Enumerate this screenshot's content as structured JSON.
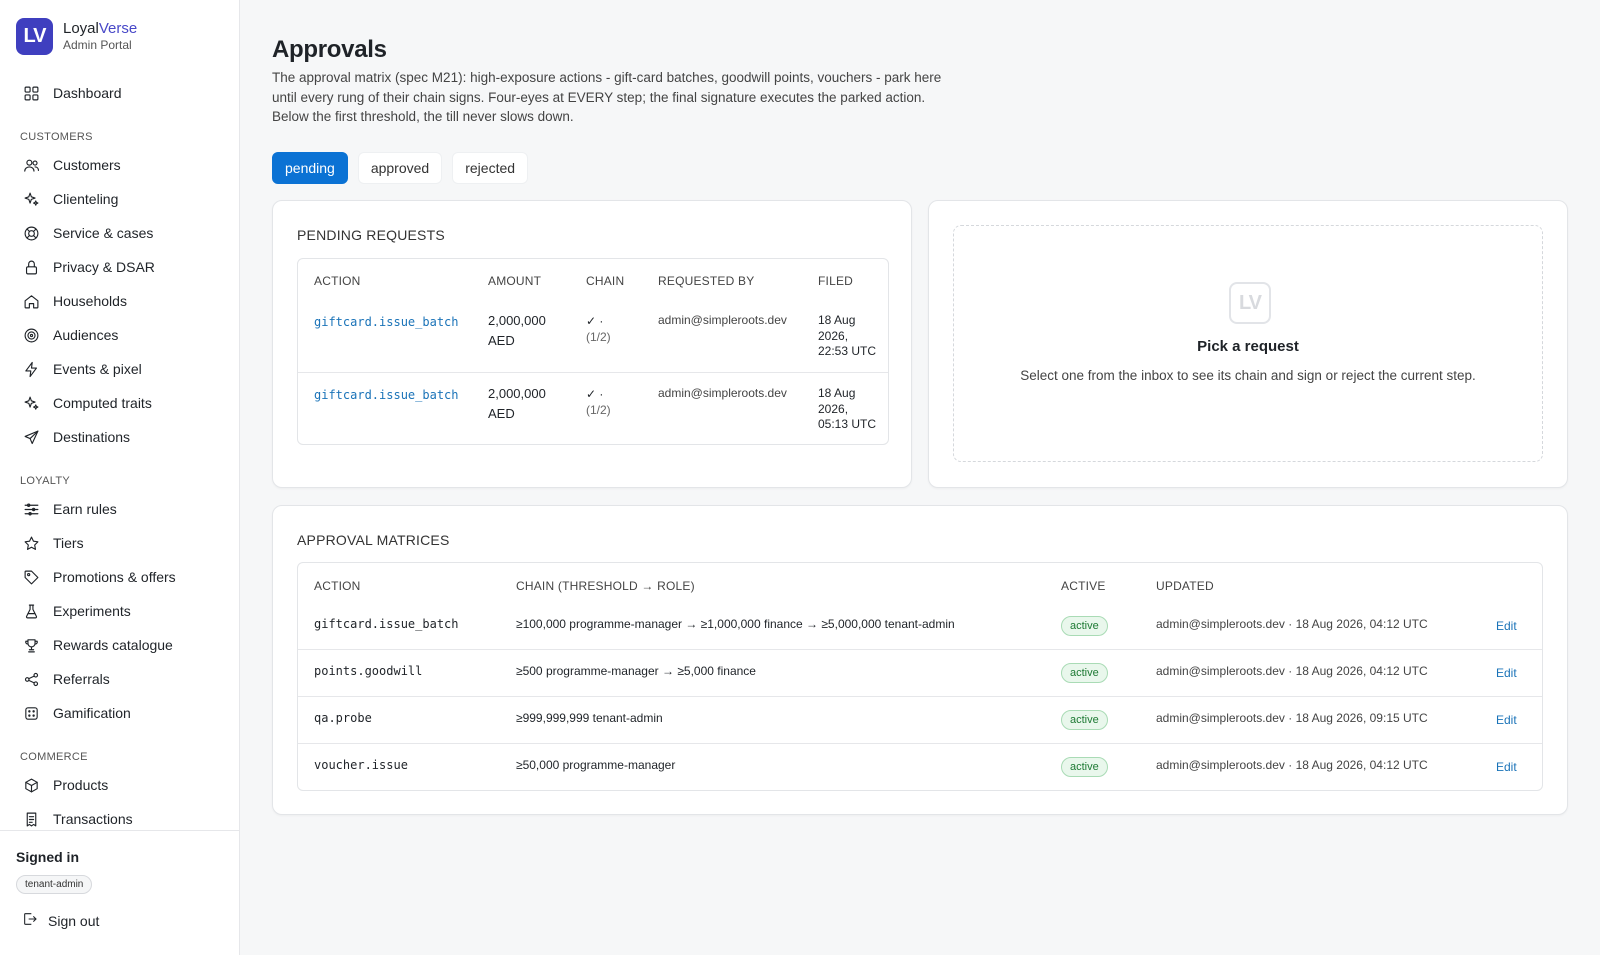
{
  "brand": {
    "logo_text": "LV",
    "name_a": "Loyal",
    "name_b": "Verse",
    "subtitle": "Admin Portal"
  },
  "nav": {
    "dashboard": "Dashboard",
    "sections": {
      "customers": "CUSTOMERS",
      "loyalty": "LOYALTY",
      "commerce": "COMMERCE"
    },
    "customers_items": [
      "Customers",
      "Clienteling",
      "Service & cases",
      "Privacy & DSAR",
      "Households",
      "Audiences",
      "Events & pixel",
      "Computed traits",
      "Destinations"
    ],
    "loyalty_items": [
      "Earn rules",
      "Tiers",
      "Promotions & offers",
      "Experiments",
      "Rewards catalogue",
      "Referrals",
      "Gamification"
    ],
    "commerce_items": [
      "Products",
      "Transactions"
    ]
  },
  "session": {
    "label": "Signed in",
    "role": "tenant-admin",
    "signout": "Sign out"
  },
  "page": {
    "title": "Approvals",
    "description": "The approval matrix (spec M21): high-exposure actions - gift-card batches, goodwill points, vouchers - park here until every rung of their chain signs. Four-eyes at EVERY step; the final signature executes the parked action. Below the first threshold, the till never slows down."
  },
  "tabs": [
    "pending",
    "approved",
    "rejected"
  ],
  "pending": {
    "title": "PENDING REQUESTS",
    "headers": [
      "ACTION",
      "AMOUNT",
      "CHAIN",
      "REQUESTED BY",
      "FILED"
    ],
    "rows": [
      {
        "action": "giftcard.issue_batch",
        "amount": "2,000,000",
        "currency": "AED",
        "chain": "✓ ·",
        "chain_progress": "(1/2)",
        "requested_by": "admin@simpleroots.dev",
        "filed_date": "18 Aug",
        "filed_year": "2026,",
        "filed_time": "22:53 UTC"
      },
      {
        "action": "giftcard.issue_batch",
        "amount": "2,000,000",
        "currency": "AED",
        "chain": "✓ ·",
        "chain_progress": "(1/2)",
        "requested_by": "admin@simpleroots.dev",
        "filed_date": "18 Aug",
        "filed_year": "2026,",
        "filed_time": "05:13 UTC"
      }
    ]
  },
  "detail": {
    "logo_text": "LV",
    "title": "Pick a request",
    "text": "Select one from the inbox to see its chain and sign or reject the current step."
  },
  "matrices": {
    "title": "APPROVAL MATRICES",
    "headers": [
      "ACTION",
      "CHAIN (THRESHOLD → ROLE)",
      "ACTIVE",
      "UPDATED"
    ],
    "rows": [
      {
        "action": "giftcard.issue_batch",
        "chain": "≥100,000 programme-manager → ≥1,000,000 finance → ≥5,000,000 tenant-admin",
        "active": "active",
        "updated": "admin@simpleroots.dev · 18 Aug 2026, 04:12 UTC",
        "edit": "Edit"
      },
      {
        "action": "points.goodwill",
        "chain": "≥500 programme-manager → ≥5,000 finance",
        "active": "active",
        "updated": "admin@simpleroots.dev · 18 Aug 2026, 04:12 UTC",
        "edit": "Edit"
      },
      {
        "action": "qa.probe",
        "chain": "≥999,999,999 tenant-admin",
        "active": "active",
        "updated": "admin@simpleroots.dev · 18 Aug 2026, 09:15 UTC",
        "edit": "Edit"
      },
      {
        "action": "voucher.issue",
        "chain": "≥50,000 programme-manager",
        "active": "active",
        "updated": "admin@simpleroots.dev · 18 Aug 2026, 04:12 UTC",
        "edit": "Edit"
      }
    ]
  },
  "colors": {
    "accent": "#0b72d4",
    "brand": "#3f3fbf",
    "link": "#1a73b8",
    "active_badge": "#1e7a34"
  }
}
